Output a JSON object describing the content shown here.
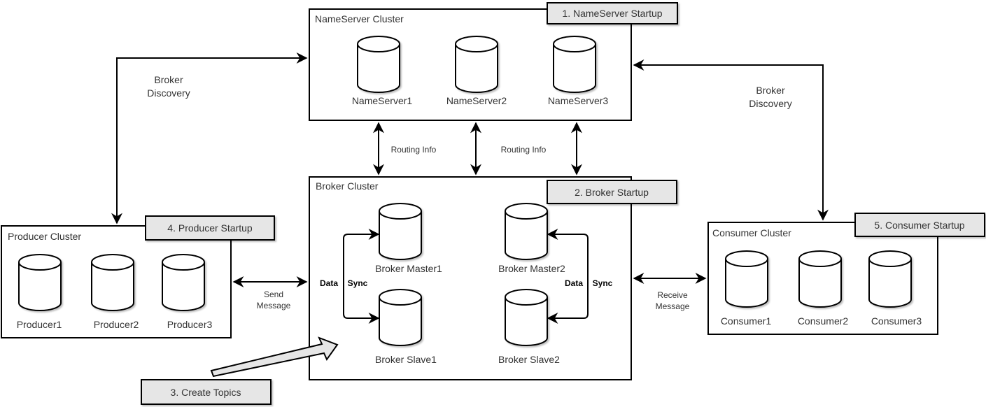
{
  "clusters": {
    "nameserver": {
      "title": "NameServer Cluster",
      "nodes": [
        "NameServer1",
        "NameServer2",
        "NameServer3"
      ],
      "step": "1. NameServer Startup"
    },
    "broker": {
      "title": "Broker Cluster",
      "masters": [
        "Broker Master1",
        "Broker Master2"
      ],
      "slaves": [
        "Broker Slave1",
        "Broker Slave2"
      ],
      "step": "2. Broker Startup"
    },
    "producer": {
      "title": "Producer Cluster",
      "nodes": [
        "Producer1",
        "Producer2",
        "Producer3"
      ],
      "step": "4. Producer Startup"
    },
    "consumer": {
      "title": "Consumer Cluster",
      "nodes": [
        "Consumer1",
        "Consumer2",
        "Consumer3"
      ],
      "step": "5. Consumer Startup"
    }
  },
  "edges": {
    "broker_discovery_left": [
      "Broker",
      "Discovery"
    ],
    "broker_discovery_right": [
      "Broker",
      "Discovery"
    ],
    "routing_info": "Routing Info",
    "send_message": [
      "Send",
      "Message"
    ],
    "receive_message": [
      "Receive",
      "Message"
    ],
    "data_sync": [
      "Data",
      "Sync"
    ]
  },
  "create_topics": "3. Create Topics",
  "colors": {
    "stroke": "#000000",
    "label_fill": "#e6e6e6",
    "text": "#333333"
  }
}
